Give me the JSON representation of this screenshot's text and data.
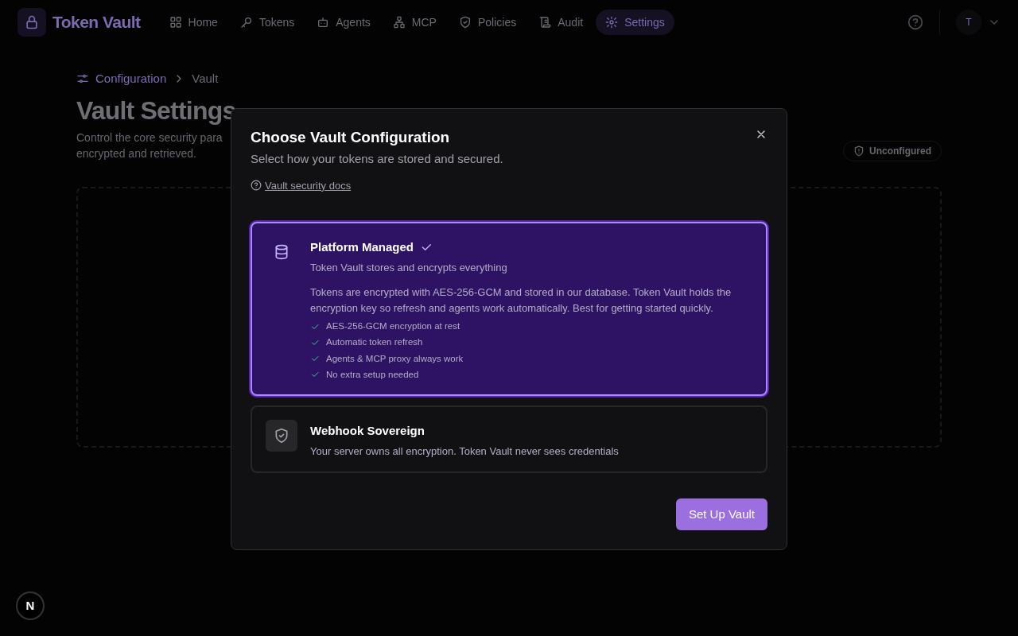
{
  "app": {
    "name": "Token Vault"
  },
  "nav": [
    {
      "label": "Home",
      "kind": "home",
      "selected": false
    },
    {
      "label": "Tokens",
      "kind": "key",
      "selected": false
    },
    {
      "label": "Agents",
      "kind": "bot",
      "selected": false
    },
    {
      "label": "MCP",
      "kind": "network",
      "selected": false
    },
    {
      "label": "Policies",
      "kind": "shield",
      "selected": false
    },
    {
      "label": "Audit",
      "kind": "scroll",
      "selected": false
    },
    {
      "label": "Settings",
      "kind": "gear",
      "selected": true
    }
  ],
  "user": {
    "initial": "T"
  },
  "breadcrumb": [
    "Configuration",
    "Vault"
  ],
  "page": {
    "title": "Vault Settings",
    "description": [
      "Control the core security para",
      "encrypted and retrieved."
    ],
    "status_badge": "Unconfigured"
  },
  "dialog": {
    "title": "Choose Vault Configuration",
    "subtitle": "Select how your tokens are stored and secured.",
    "docs_link": "Vault security docs",
    "options": [
      {
        "kind": "platform",
        "title": "Platform Managed",
        "summary": "Token Vault stores and encrypts everything",
        "selected": true,
        "details": "Tokens are encrypted with AES-256-GCM and stored in our database. Token Vault holds the encryption key so refresh and agents work automatically. Best for getting started quickly.",
        "features": [
          "AES-256-GCM encryption at rest",
          "Automatic token refresh",
          "Agents & MCP proxy always work",
          "No extra setup needed"
        ]
      },
      {
        "kind": "webhook",
        "title": "Webhook Sovereign",
        "summary": "Your server owns all encryption. Token Vault never sees credentials",
        "selected": false
      }
    ],
    "primary_button": "Set Up Vault"
  },
  "dev_badge": "N"
}
